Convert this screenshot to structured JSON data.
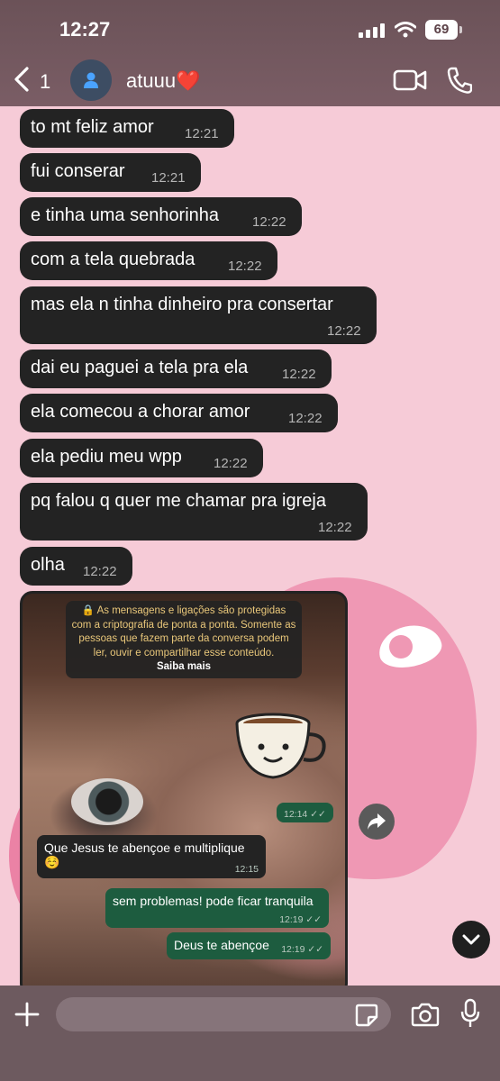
{
  "status_bar": {
    "time": "12:27",
    "battery": "69"
  },
  "header": {
    "back_count": "1",
    "contact_name": "atuuu❤️"
  },
  "messages": [
    {
      "text": "to mt feliz amor",
      "time": "12:21"
    },
    {
      "text": "fui conserar",
      "time": "12:21"
    },
    {
      "text": "e tinha uma senhorinha",
      "time": "12:22"
    },
    {
      "text": "com a tela quebrada",
      "time": "12:22"
    },
    {
      "text": "mas ela n tinha dinheiro pra consertar",
      "time": "12:22"
    },
    {
      "text": "dai eu paguei a tela pra ela",
      "time": "12:22"
    },
    {
      "text": "ela comecou a chorar amor",
      "time": "12:22"
    },
    {
      "text": "ela pediu meu wpp",
      "time": "12:22"
    },
    {
      "text": "pq falou q quer me chamar pra igreja",
      "time": "12:22"
    },
    {
      "text": "olha",
      "time": "12:22"
    }
  ],
  "screenshot": {
    "notice_text": "🔒 As mensagens e ligações são protegidas com a criptografia de ponta a ponta. Somente as pessoas que fazem parte da conversa podem ler, ouvir e compartilhar esse conteúdo.",
    "notice_link": "Saiba mais",
    "sticker_time": "12:14 ✓✓",
    "inner_messages": [
      {
        "text": "Que Jesus te abençoe e multiplique ☺️",
        "time": "12:15",
        "dir": "in"
      },
      {
        "text": "sem problemas! pode ficar tranquila",
        "time": "12:19 ✓✓",
        "dir": "out"
      },
      {
        "text": "Deus te abençoe",
        "time": "12:19 ✓✓",
        "dir": "out"
      }
    ]
  },
  "composer": {
    "placeholder": ""
  },
  "colors": {
    "wallpaper": "#f6cbd7",
    "bubble_in": "#232323",
    "bubble_out": "#1d5c3f"
  }
}
